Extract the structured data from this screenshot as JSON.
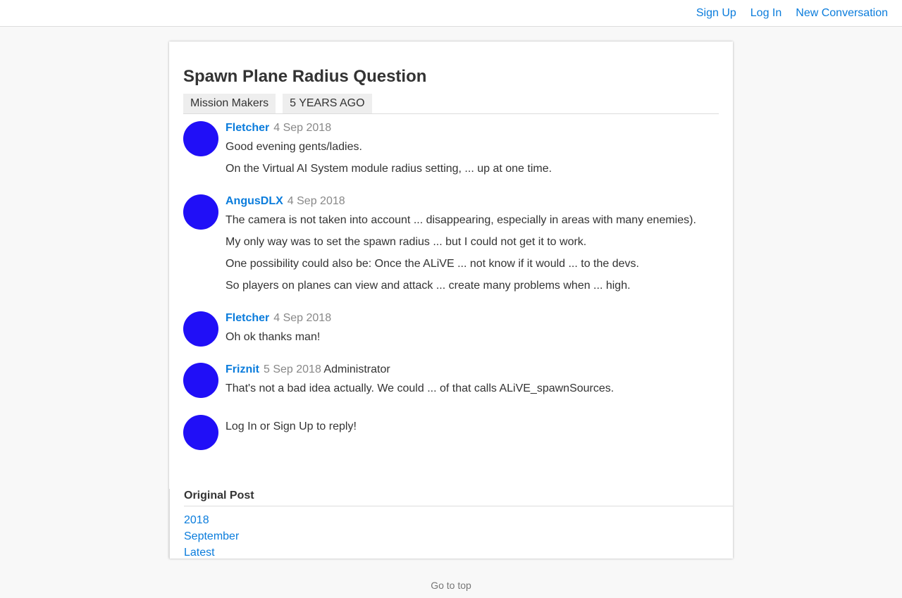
{
  "header": {
    "sign_up": "Sign Up",
    "log_in": "Log In",
    "new_conversation": "New Conversation"
  },
  "conversation": {
    "title": "Spawn Plane Radius Question",
    "channel": "Mission Makers",
    "age": "5 YEARS AGO"
  },
  "posts": [
    {
      "author": "Fletcher",
      "date": "4 Sep 2018",
      "role": "",
      "paragraphs": [
        "Good evening gents/ladies.",
        "On the Virtual AI System module radius setting, ... up at one time."
      ]
    },
    {
      "author": "AngusDLX",
      "date": "4 Sep 2018",
      "role": "",
      "paragraphs": [
        "The camera is not taken into account ... disappearing, especially in areas with many enemies).",
        "My only way was to set the spawn radius ... but I could not get it to work.",
        "One possibility could also be: Once the ALiVE ... not know if it would ... to the devs.",
        "So players on planes can view and attack ... create many problems when ... high."
      ]
    },
    {
      "author": "Fletcher",
      "date": "4 Sep 2018",
      "role": "",
      "paragraphs": [
        "Oh ok thanks man!"
      ]
    },
    {
      "author": "Friznit",
      "date": "5 Sep 2018",
      "role": "Administrator",
      "paragraphs": [
        "That's not a bad idea actually. We could ... of that calls ALiVE_spawnSources."
      ]
    }
  ],
  "reply": {
    "log_in": "Log In",
    "or": " or ",
    "sign_up": "Sign Up",
    "suffix": " to reply!"
  },
  "scrubber": {
    "original_post": "Original Post",
    "year": "2018",
    "month": "September",
    "latest": "Latest"
  },
  "footer": {
    "go_to_top": "Go to top"
  },
  "colors": {
    "link": "#0a7cdc",
    "avatar": "#200ff7"
  }
}
